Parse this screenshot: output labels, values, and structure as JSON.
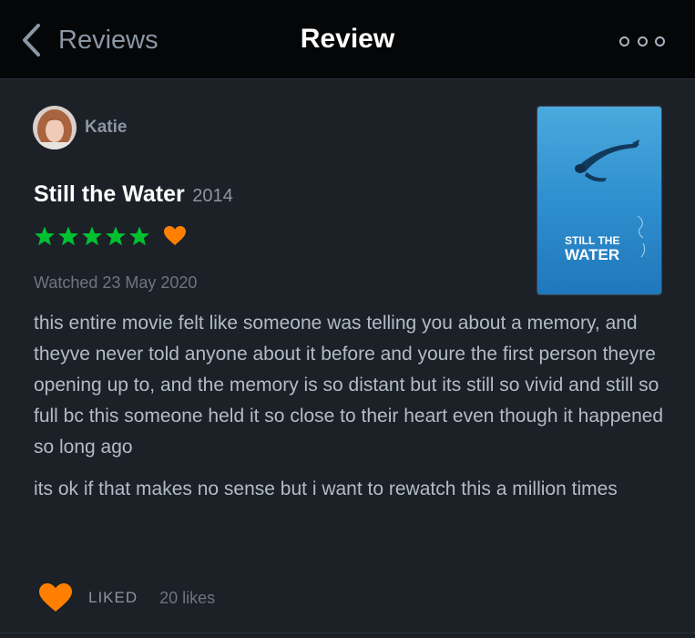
{
  "header": {
    "back_label": "Reviews",
    "title": "Review",
    "back_icon": "chevron-left-icon",
    "more_icon": "more-options-icon"
  },
  "reviewer": {
    "name": "Katie"
  },
  "film": {
    "title": "Still the Water",
    "year": "2014",
    "poster_title_line1": "STILL THE",
    "poster_title_line2": "WATER"
  },
  "rating": {
    "stars": 5,
    "max_stars": 5,
    "liked_heart": true,
    "star_color": "#00c030",
    "heart_color": "#ff8000"
  },
  "watched": "Watched 23 May 2020",
  "review": {
    "paragraphs": [
      "this entire movie felt like someone was telling you about a memory, and theyve never told anyone about it before and youre the first person theyre opening up to, and the memory is so distant but its still so vivid and still so full bc this someone held it so close to their heart even though it happened so long ago",
      "its ok if that makes no sense but i want to rewatch this a million times"
    ]
  },
  "footer": {
    "liked_label": "LIKED",
    "likes_count": "20 likes"
  },
  "colors": {
    "background": "#1c2027",
    "topbar": "#050608",
    "accent_orange": "#ff8000",
    "accent_green": "#00c030"
  }
}
